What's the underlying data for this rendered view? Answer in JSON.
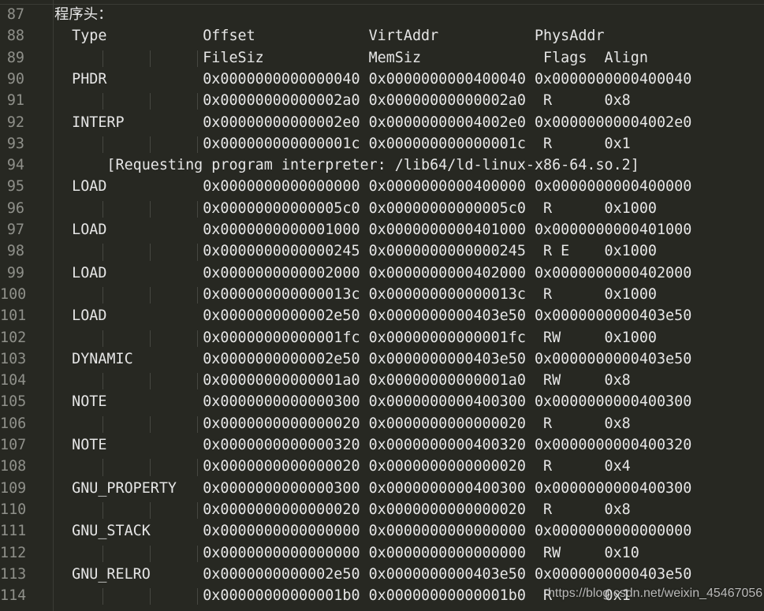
{
  "editor": {
    "lines": [
      {
        "num": "87",
        "text": "程序头："
      },
      {
        "num": "88",
        "text": "  Type           Offset             VirtAddr           PhysAddr"
      },
      {
        "num": "89",
        "text": "                 FileSiz            MemSiz              Flags  Align"
      },
      {
        "num": "90",
        "text": "  PHDR           0x0000000000000040 0x0000000000400040 0x0000000000400040"
      },
      {
        "num": "91",
        "text": "                 0x00000000000002a0 0x00000000000002a0  R      0x8"
      },
      {
        "num": "92",
        "text": "  INTERP         0x00000000000002e0 0x00000000004002e0 0x00000000004002e0"
      },
      {
        "num": "93",
        "text": "                 0x000000000000001c 0x000000000000001c  R      0x1"
      },
      {
        "num": "94",
        "text": "      [Requesting program interpreter: /lib64/ld-linux-x86-64.so.2]"
      },
      {
        "num": "95",
        "text": "  LOAD           0x0000000000000000 0x0000000000400000 0x0000000000400000"
      },
      {
        "num": "96",
        "text": "                 0x00000000000005c0 0x00000000000005c0  R      0x1000"
      },
      {
        "num": "97",
        "text": "  LOAD           0x0000000000001000 0x0000000000401000 0x0000000000401000"
      },
      {
        "num": "98",
        "text": "                 0x0000000000000245 0x0000000000000245  R E    0x1000"
      },
      {
        "num": "99",
        "text": "  LOAD           0x0000000000002000 0x0000000000402000 0x0000000000402000"
      },
      {
        "num": "100",
        "text": "                 0x000000000000013c 0x000000000000013c  R      0x1000"
      },
      {
        "num": "101",
        "text": "  LOAD           0x0000000000002e50 0x0000000000403e50 0x0000000000403e50"
      },
      {
        "num": "102",
        "text": "                 0x00000000000001fc 0x00000000000001fc  RW     0x1000"
      },
      {
        "num": "103",
        "text": "  DYNAMIC        0x0000000000002e50 0x0000000000403e50 0x0000000000403e50"
      },
      {
        "num": "104",
        "text": "                 0x00000000000001a0 0x00000000000001a0  RW     0x8"
      },
      {
        "num": "105",
        "text": "  NOTE           0x0000000000000300 0x0000000000400300 0x0000000000400300"
      },
      {
        "num": "106",
        "text": "                 0x0000000000000020 0x0000000000000020  R      0x8"
      },
      {
        "num": "107",
        "text": "  NOTE           0x0000000000000320 0x0000000000400320 0x0000000000400320"
      },
      {
        "num": "108",
        "text": "                 0x0000000000000020 0x0000000000000020  R      0x4"
      },
      {
        "num": "109",
        "text": "  GNU_PROPERTY   0x0000000000000300 0x0000000000400300 0x0000000000400300"
      },
      {
        "num": "110",
        "text": "                 0x0000000000000020 0x0000000000000020  R      0x8"
      },
      {
        "num": "111",
        "text": "  GNU_STACK      0x0000000000000000 0x0000000000000000 0x0000000000000000"
      },
      {
        "num": "112",
        "text": "                 0x0000000000000000 0x0000000000000000  RW     0x10"
      },
      {
        "num": "113",
        "text": "  GNU_RELRO      0x0000000000002e50 0x0000000000403e50 0x0000000000403e50"
      },
      {
        "num": "114",
        "text": "                 0x00000000000001b0 0x00000000000001b0  R      0x1"
      }
    ]
  },
  "watermark": "https://blog.csdn.net/weixin_45467056",
  "colors": {
    "background": "#272822",
    "text": "#e6e6e6",
    "line_number": "#8f908a",
    "indent_guide": "#464741"
  }
}
